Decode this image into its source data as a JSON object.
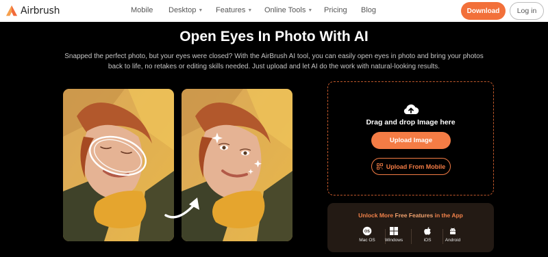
{
  "header": {
    "brand": "Airbrush",
    "nav": [
      {
        "label": "Mobile",
        "has_caret": false
      },
      {
        "label": "Desktop",
        "has_caret": true
      },
      {
        "label": "Features",
        "has_caret": true
      },
      {
        "label": "Online Tools",
        "has_caret": true
      },
      {
        "label": "Pricing",
        "has_caret": false
      },
      {
        "label": "Blog",
        "has_caret": false
      }
    ],
    "download_label": "Download",
    "login_label": "Log in"
  },
  "hero": {
    "title": "Open Eyes In Photo With AI",
    "description": "Snapped the perfect photo, but your eyes were closed? With the AirBrush AI tool, you can easily open eyes in photo and bring your photos back to life, no retakes or editing skills needed. Just upload and let AI do the work with natural-looking results."
  },
  "upload": {
    "icon": "cloud-upload-icon",
    "drag_text": "Drag and drop Image here",
    "upload_button": "Upload Image",
    "mobile_button": "Upload From Mobile"
  },
  "app_panel": {
    "title_prefix": "Unlock More ",
    "title_highlight": "Free Features",
    "title_suffix": " in the App",
    "platforms": [
      {
        "icon": "macos-icon",
        "label": "Mac OS"
      },
      {
        "icon": "windows-icon",
        "label": "Windows"
      },
      {
        "icon": "apple-icon",
        "label": "iOS"
      },
      {
        "icon": "android-icon",
        "label": "Android"
      }
    ]
  },
  "colors": {
    "accent": "#f47c45",
    "background": "#000000",
    "panel": "#231a14"
  }
}
